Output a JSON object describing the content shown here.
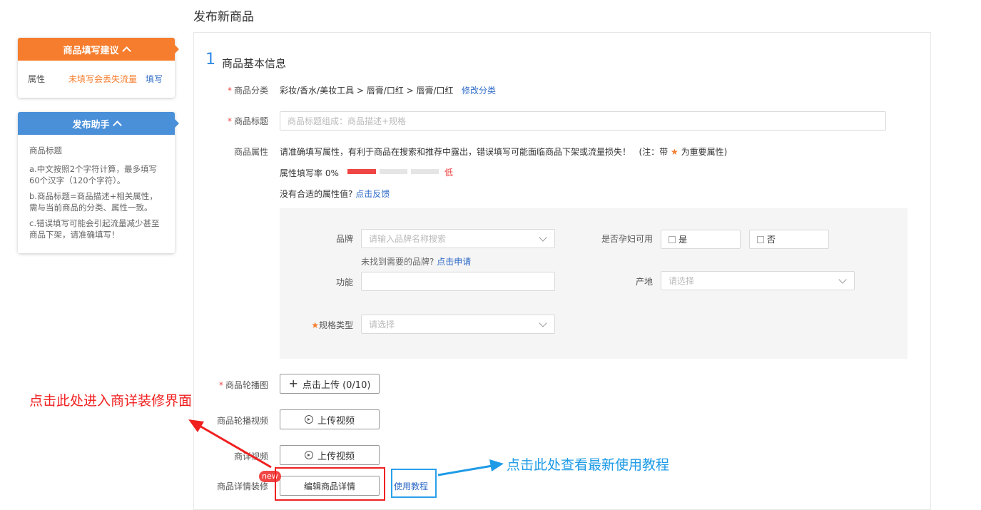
{
  "page": {
    "title": "发布新商品"
  },
  "suggest_card": {
    "header": "商品填写建议",
    "row_label": "属性",
    "row_warning": "未填写会丢失流量",
    "row_action": "填写"
  },
  "helper_card": {
    "header": "发布助手",
    "topic": "商品标题",
    "tips": [
      "a.中文按照2个字符计算，最多填写60个汉字（120个字符）。",
      "b.商品标题=商品描述+相关属性，需与当前商品的分类、属性一致。",
      "c.错误填写可能会引起流量减少甚至商品下架，请准确填写！"
    ]
  },
  "section": {
    "number": "1",
    "title": "商品基本信息"
  },
  "category": {
    "label": "商品分类",
    "path": "彩妆/香水/美妆工具 > 唇膏/口红 > 唇膏/口红",
    "edit": "修改分类"
  },
  "title_field": {
    "label": "商品标题",
    "placeholder": "商品标题组成：商品描述+规格"
  },
  "attributes": {
    "label": "商品属性",
    "notice": "请准确填写属性，有利于商品在搜索和推荐中露出，错误填写可能面临商品下架或流量损失！",
    "note_prefix": "(注：带",
    "note_suffix": "为重要属性)",
    "fill_rate_label": "属性填写率 0%",
    "fill_rate": 0,
    "fill_level": "低",
    "feedback_prefix": "没有合适的属性值?",
    "feedback_link": "点击反馈"
  },
  "attr_form": {
    "brand_label": "品牌",
    "brand_placeholder": "请输入品牌名称搜索",
    "brand_hint_prefix": "未找到需要的品牌?",
    "brand_hint_link": "点击申请",
    "pregnant_label": "是否孕妇可用",
    "pregnant_yes": "是",
    "pregnant_no": "否",
    "function_label": "功能",
    "origin_label": "产地",
    "origin_placeholder": "请选择",
    "spec_label": "规格类型",
    "spec_placeholder": "请选择"
  },
  "carousel": {
    "label": "商品轮播图",
    "button": "点击上传 (0/10)"
  },
  "carousel_video": {
    "label": "商品轮播视频",
    "button": "上传视频"
  },
  "detail_video": {
    "label": "商详视频",
    "button": "上传视频"
  },
  "detail_decor": {
    "label": "商品详情装修",
    "badge": "new",
    "button": "编辑商品详情",
    "tutorial": "使用教程"
  },
  "annotations": {
    "red": "点击此处进入商详装修界面",
    "blue": "点击此处查看最新使用教程"
  },
  "colors": {
    "orange": "#f57d2d",
    "blue": "#4a90d9",
    "red": "#f04545",
    "annotation_red": "#f02020",
    "annotation_blue": "#1e9be6"
  }
}
